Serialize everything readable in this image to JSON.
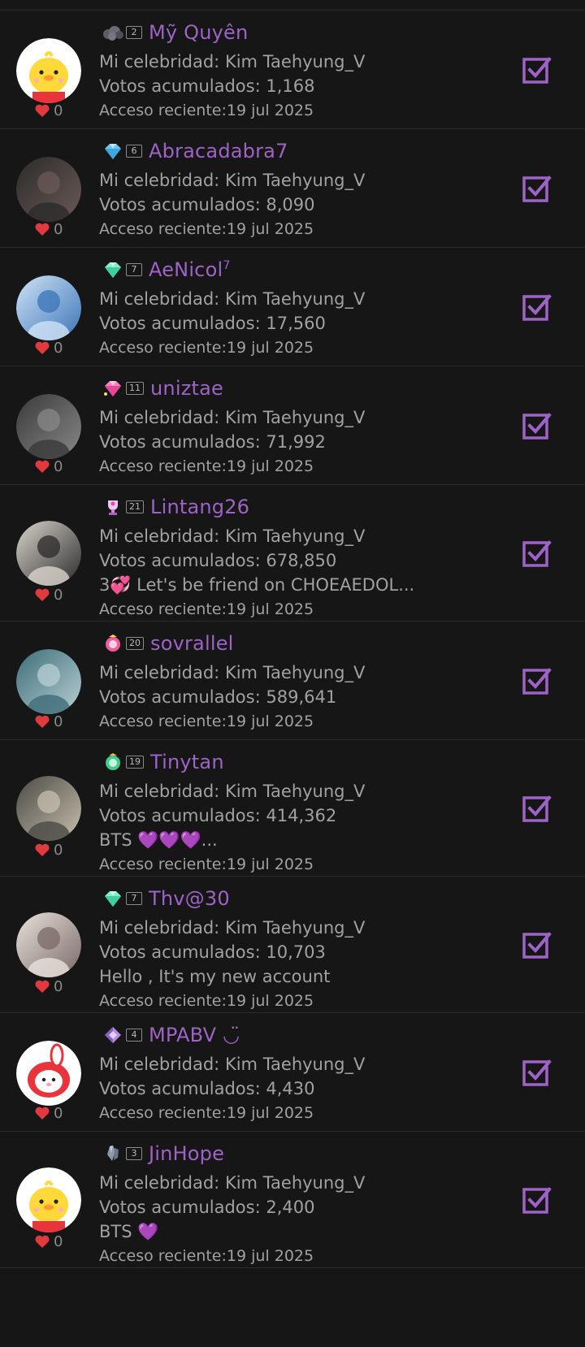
{
  "celebrity_prefix": "Mi celebridad: ",
  "votes_prefix": "Votos acumulados: ",
  "recent_prefix": "Acceso reciente:",
  "accent_color": "#9d63c6",
  "heart_color": "#e0393e",
  "users": [
    {
      "name": "Mỹ Quyên",
      "name_sup": "",
      "level": "2",
      "badge_icon": "rock-badge-icon",
      "avatar": "duck-avatar",
      "likes": "0",
      "celebrity": "Kim Taehyung_V",
      "votes": "1,168",
      "status": "",
      "recent": "19 jul 2025"
    },
    {
      "name": "Abracadabra7",
      "name_sup": "",
      "level": "6",
      "badge_icon": "blue-diamond-badge-icon",
      "avatar": "photo-avatar",
      "likes": "0",
      "celebrity": "Kim Taehyung_V",
      "votes": "8,090",
      "status": "",
      "recent": "19 jul 2025"
    },
    {
      "name": "AeNicol",
      "name_sup": "7",
      "level": "7",
      "badge_icon": "mint-diamond-badge-icon",
      "avatar": "photo-avatar",
      "likes": "0",
      "celebrity": "Kim Taehyung_V",
      "votes": "17,560",
      "status": "",
      "recent": "19 jul 2025"
    },
    {
      "name": "uniztae",
      "name_sup": "",
      "level": "11",
      "badge_icon": "pink-diamond-badge-icon",
      "avatar": "photo-avatar",
      "likes": "0",
      "celebrity": "Kim Taehyung_V",
      "votes": "71,992",
      "status": "",
      "recent": "19 jul 2025"
    },
    {
      "name": "Lintang26",
      "name_sup": "",
      "level": "21",
      "badge_icon": "trophy-badge-icon",
      "avatar": "photo-avatar",
      "likes": "0",
      "celebrity": "Kim Taehyung_V",
      "votes": "678,850",
      "status": "3💞  Let's be friend on CHOEAEDOL...",
      "recent": "19 jul 2025"
    },
    {
      "name": "sovrallel",
      "name_sup": "",
      "level": "20",
      "badge_icon": "pink-emblem-badge-icon",
      "avatar": "photo-avatar",
      "likes": "0",
      "celebrity": "Kim Taehyung_V",
      "votes": "589,641",
      "status": "",
      "recent": "19 jul 2025"
    },
    {
      "name": "Tinytan",
      "name_sup": "",
      "level": "19",
      "badge_icon": "green-emblem-badge-icon",
      "avatar": "photo-avatar",
      "likes": "0",
      "celebrity": "Kim Taehyung_V",
      "votes": "414,362",
      "status": "BTS 💜💜💜...",
      "recent": "19 jul 2025"
    },
    {
      "name": "Thv@30",
      "name_sup": "",
      "level": "7",
      "badge_icon": "mint-diamond-badge-icon",
      "avatar": "photo-avatar",
      "likes": "0",
      "celebrity": "Kim Taehyung_V",
      "votes": "10,703",
      "status": "Hello , It's my new account",
      "recent": "19 jul 2025"
    },
    {
      "name": "MPABV ◡̈",
      "name_sup": "",
      "level": "4",
      "badge_icon": "purple-gem-badge-icon",
      "avatar": "bunny-avatar",
      "likes": "0",
      "celebrity": "Kim Taehyung_V",
      "votes": "4,430",
      "status": "",
      "recent": "19 jul 2025"
    },
    {
      "name": "JinHope",
      "name_sup": "",
      "level": "3",
      "badge_icon": "gray-crystal-badge-icon",
      "avatar": "duck-avatar",
      "likes": "0",
      "celebrity": "Kim Taehyung_V",
      "votes": "2,400",
      "status": "BTS 💜",
      "recent": "19 jul 2025"
    }
  ]
}
